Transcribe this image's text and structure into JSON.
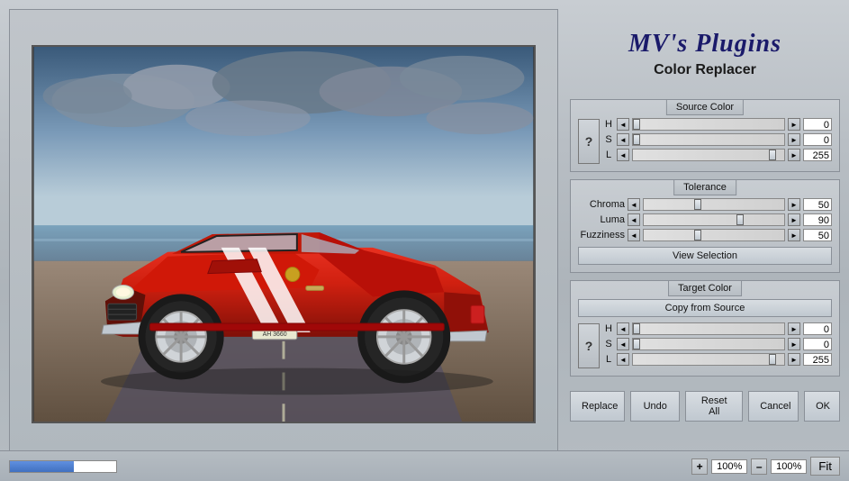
{
  "app": {
    "logo_signature": "MV's Plugins",
    "subtitle": "Color Replacer"
  },
  "source_color": {
    "title": "Source Color",
    "h_label": "H",
    "s_label": "S",
    "l_label": "L",
    "h_value": "0",
    "s_value": "0",
    "l_value": "255",
    "h_thumb_pos": "0",
    "s_thumb_pos": "0",
    "l_thumb_pos": "98",
    "question_mark": "?"
  },
  "tolerance": {
    "title": "Tolerance",
    "chroma_label": "Chroma",
    "luma_label": "Luma",
    "fuzziness_label": "Fuzziness",
    "chroma_value": "50",
    "luma_value": "90",
    "fuzziness_value": "50",
    "chroma_thumb_pos": "40",
    "luma_thumb_pos": "72",
    "fuzziness_thumb_pos": "40",
    "view_selection_label": "View Selection"
  },
  "target_color": {
    "title": "Target Color",
    "h_label": "H",
    "s_label": "S",
    "l_label": "L",
    "h_value": "0",
    "s_value": "0",
    "l_value": "255",
    "h_thumb_pos": "0",
    "s_thumb_pos": "0",
    "l_thumb_pos": "98",
    "question_mark": "?",
    "copy_from_source_label": "Copy from Source"
  },
  "bottom_buttons": {
    "replace": "Replace",
    "undo": "Undo",
    "reset_all": "Reset All",
    "cancel": "Cancel",
    "ok": "OK"
  },
  "zoom": {
    "plus": "+",
    "minus": "–",
    "value": "100%",
    "value2": "100%",
    "fit": "Fit"
  }
}
